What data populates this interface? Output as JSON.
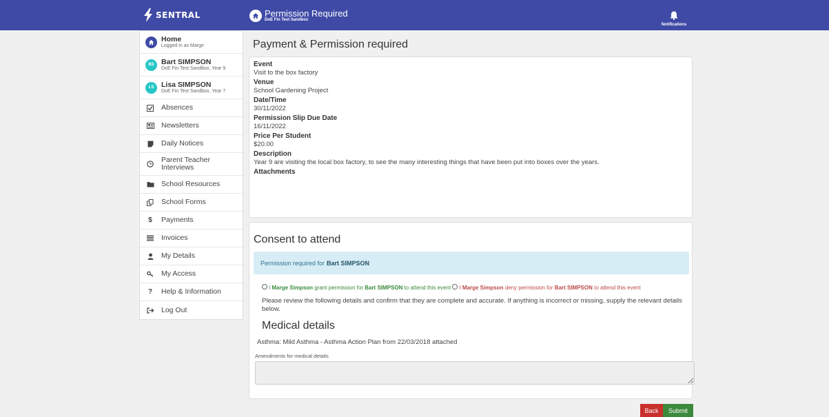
{
  "header": {
    "brand": "SENTRAL",
    "page_title": "Permission Required",
    "page_subtitle": "DoE Fin Test Sandbox",
    "notifications_label": "Notifications"
  },
  "sidebar": {
    "home": {
      "title": "Home",
      "subtitle": "Logged in as Marge"
    },
    "students": [
      {
        "initials": "BS",
        "name": "Bart SIMPSON",
        "details": "DoE Fin Test Sandbox, Year 9"
      },
      {
        "initials": "LS",
        "name": "Lisa SIMPSON",
        "details": "DoE Fin Test Sandbox, Year 7"
      }
    ],
    "items": [
      {
        "label": "Absences",
        "icon": "checkbox-icon"
      },
      {
        "label": "Newsletters",
        "icon": "newspaper-icon"
      },
      {
        "label": "Daily Notices",
        "icon": "bookmark-icon"
      },
      {
        "label": "Parent Teacher Interviews",
        "icon": "clock-icon"
      },
      {
        "label": "School Resources",
        "icon": "folder-icon"
      },
      {
        "label": "School Forms",
        "icon": "forms-icon"
      },
      {
        "label": "Payments",
        "icon": "dollar-icon"
      },
      {
        "label": "Invoices",
        "icon": "list-icon"
      },
      {
        "label": "My Details",
        "icon": "user-icon"
      },
      {
        "label": "My Access",
        "icon": "key-icon"
      },
      {
        "label": "Help & Information",
        "icon": "question-icon"
      },
      {
        "label": "Log Out",
        "icon": "logout-icon"
      }
    ]
  },
  "main": {
    "heading": "Payment & Permission required",
    "details": [
      {
        "label": "Event",
        "value": "Visit to the box factory"
      },
      {
        "label": "Venue",
        "value": "School Gardening Project"
      },
      {
        "label": "Date/Time",
        "value": "30/11/2022"
      },
      {
        "label": "Permission Slip Due Date",
        "value": "16/11/2022"
      },
      {
        "label": "Price Per Student",
        "value": "$20.00"
      },
      {
        "label": "Description",
        "value": "Year 9 are visiting the local box factory, to see the many interesting things that have been put into boxes over the years."
      },
      {
        "label": "Attachments",
        "value": ""
      }
    ],
    "consent": {
      "title": "Consent to attend",
      "alert_prefix": "Permission required for",
      "alert_student": "Bart SIMPSON",
      "grant": {
        "lead": "I",
        "parent": "Marge Simpson",
        "mid": "grant permission for",
        "student": "Bart SIMPSON",
        "tail": "to attend this event"
      },
      "deny": {
        "lead": "I",
        "parent": "Marge Simpson",
        "mid": "deny permission for",
        "student": "Bart SIMPSON",
        "tail": "to attend this event"
      },
      "review_text": "Please review the following details and confirm that they are complete and accurate. If anything is incorrect or missing, supply the relevant details below.",
      "medical_title": "Medical details",
      "medical_text": "Asthma: Mild Asthma - Asthma Action Plan from 22/03/2018 attached",
      "amend_label": "Amendments for medical details",
      "amend_value": ""
    },
    "buttons": {
      "back": "Back",
      "submit": "Submit"
    }
  },
  "colors": {
    "topbar": "#3f4aa6",
    "avatar_student": "#26c6c6",
    "grant_text": "#3a8a3a",
    "deny_text": "#b94a48",
    "alert_bg": "#d7edf5",
    "back_button": "#c9302c",
    "submit_button": "#3c8a3c"
  }
}
